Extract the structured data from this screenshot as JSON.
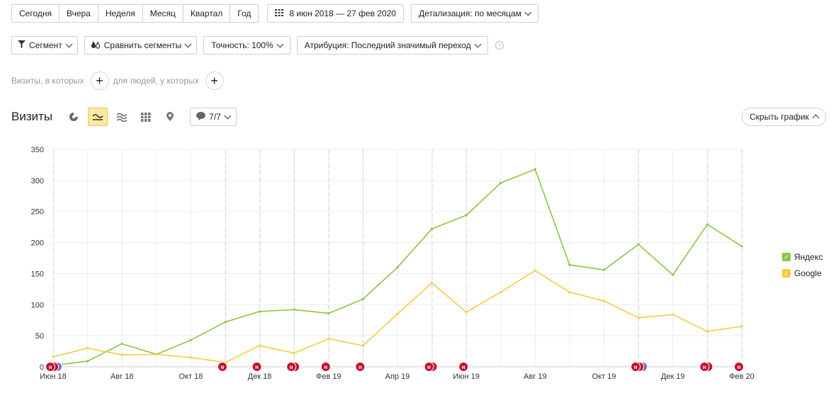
{
  "periods": [
    "Сегодня",
    "Вчера",
    "Неделя",
    "Месяц",
    "Квартал",
    "Год"
  ],
  "date_range": "8 июн 2018 — 27 фев 2020",
  "detail": "Детализация: по месяцам",
  "toolbar2": {
    "segment": "Сегмент",
    "compare": "Сравнить сегменты",
    "accuracy": "Точность: 100%",
    "attribution": "Атрибуция: Последний значимый переход",
    "help": "?"
  },
  "filters": {
    "visits_where": "Визиты, в которых",
    "people_where": "для людей, у которых",
    "plus": "+"
  },
  "view": {
    "title": "Визиты",
    "notes_count": "7/7",
    "hide_chart": "Скрыть график"
  },
  "colors": {
    "yandex": "#8cc63f",
    "google": "#f5cd3c",
    "marker": "#c8102e",
    "marker_alt": "#7b6fc9"
  },
  "chart_data": {
    "type": "line",
    "title": "",
    "xlabel": "",
    "ylabel": "",
    "ylim": [
      0,
      350
    ],
    "yticks": [
      0,
      50,
      100,
      150,
      200,
      250,
      300,
      350
    ],
    "grid": true,
    "legend_position": "right",
    "x": [
      "2018-06",
      "2018-07",
      "2018-08",
      "2018-09",
      "2018-10",
      "2018-11",
      "2018-12",
      "2019-01",
      "2019-02",
      "2019-03",
      "2019-04",
      "2019-05",
      "2019-06",
      "2019-07",
      "2019-08",
      "2019-09",
      "2019-10",
      "2019-11",
      "2019-12",
      "2020-01",
      "2020-02"
    ],
    "x_tick_labels": [
      {
        "x": "2018-06",
        "label": "Июн 18"
      },
      {
        "x": "2018-08",
        "label": "Авг 18"
      },
      {
        "x": "2018-10",
        "label": "Окт 18"
      },
      {
        "x": "2018-12",
        "label": "Дек 18"
      },
      {
        "x": "2019-02",
        "label": "Фев 19"
      },
      {
        "x": "2019-04",
        "label": "Апр 19"
      },
      {
        "x": "2019-06",
        "label": "Июн 19"
      },
      {
        "x": "2019-08",
        "label": "Авг 19"
      },
      {
        "x": "2019-10",
        "label": "Окт 19"
      },
      {
        "x": "2019-12",
        "label": "Дек 19"
      },
      {
        "x": "2020-02",
        "label": "Фев 20"
      }
    ],
    "series": [
      {
        "name": "Яндекс",
        "color": "#8cc63f",
        "values": [
          2,
          9,
          37,
          20,
          43,
          72,
          89,
          92,
          86,
          109,
          160,
          222,
          244,
          296,
          318,
          164,
          156,
          197,
          148,
          229,
          194
        ]
      },
      {
        "name": "Google",
        "color": "#f5cd3c",
        "values": [
          16,
          30,
          19,
          20,
          15,
          7,
          34,
          22,
          45,
          34,
          85,
          135,
          88,
          120,
          155,
          120,
          106,
          79,
          84,
          57,
          65
        ]
      }
    ],
    "annotations": [
      {
        "x": "2018-06",
        "count": 3,
        "label": "н"
      },
      {
        "x": "2018-11",
        "count": 1,
        "label": "н"
      },
      {
        "x": "2018-12",
        "count": 1,
        "label": "н"
      },
      {
        "x": "2019-01",
        "count": 2,
        "label": "н"
      },
      {
        "x": "2019-02",
        "count": 1,
        "label": "н"
      },
      {
        "x": "2019-03",
        "count": 1,
        "label": "н"
      },
      {
        "x": "2019-05",
        "count": 2,
        "label": "н"
      },
      {
        "x": "2019-06",
        "count": 1,
        "label": "н"
      },
      {
        "x": "2019-11",
        "count": 3,
        "label": "н"
      },
      {
        "x": "2020-01",
        "count": 2,
        "label": "н"
      },
      {
        "x": "2020-02",
        "count": 1,
        "label": "н"
      }
    ]
  }
}
